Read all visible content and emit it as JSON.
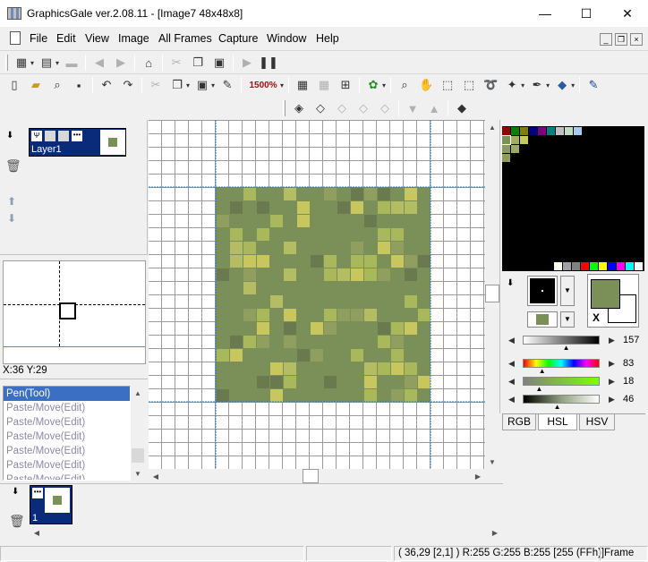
{
  "window": {
    "title": "GraphicsGale ver.2.08.11 - [Image7 48x48x8]",
    "min": "—",
    "max": "☐",
    "close": "✕"
  },
  "menu": [
    "File",
    "Edit",
    "View",
    "Image",
    "All Frames",
    "Capture",
    "Window",
    "Help"
  ],
  "mdi": {
    "min": "_",
    "restore": "❐",
    "close": "×"
  },
  "toolbar": {
    "zoom": "1500%"
  },
  "layer_panel": {
    "layer_name": "Layer1"
  },
  "navigator": {
    "coords": "X:36 Y:29"
  },
  "history": {
    "items": [
      "Pen(Tool)",
      "Paste/Move(Edit)",
      "Paste/Move(Edit)",
      "Paste/Move(Edit)",
      "Paste/Move(Edit)",
      "Paste/Move(Edit)",
      "Paste/Move(Edit)"
    ],
    "selected_index": 0
  },
  "frames": {
    "frame_number": "1"
  },
  "colors": {
    "primary": "#7b8f59",
    "secondary": "#ffffff",
    "swap_label": "X",
    "sliders": [
      {
        "label": "lightness-slider",
        "value": "157",
        "gradient": "linear-gradient(90deg,#fff,#000)",
        "marker": 52
      },
      {
        "label": "hue-slider",
        "value": "83",
        "gradient": "linear-gradient(90deg,#f00,#ff0,#0f0,#0ff,#00f,#f0f,#f00)",
        "marker": 20
      },
      {
        "label": "saturation-slider",
        "value": "18",
        "gradient": "linear-gradient(90deg,#808080,#7fff00)",
        "marker": 16
      },
      {
        "label": "luminance-slider",
        "value": "46",
        "gradient": "linear-gradient(90deg,#000,#90a080,#fff)",
        "marker": 40
      }
    ],
    "tabs": [
      "RGB",
      "HSL",
      "HSV"
    ],
    "active_tab": "HSL"
  },
  "palette": {
    "row1": [
      "#8c0000",
      "#008000",
      "#808000",
      "#000080",
      "#800080",
      "#008080",
      "#c0c0c0",
      "#c0dcc0",
      "#a6caf0",
      "#000000",
      "#000000",
      "#000000",
      "#000000",
      "#000000",
      "#000000",
      "#000000"
    ],
    "row2": [
      "#7b8f59",
      "#a0b060",
      "#c8c860",
      "#000000"
    ],
    "row3": [
      "#8c9a5e",
      "#9cac66",
      "#000000"
    ],
    "row4": [
      "#8c9e62"
    ],
    "bottom": [
      "#fffbf0",
      "#a0a0a4",
      "#808080",
      "#ff0000",
      "#00ff00",
      "#ffff00",
      "#0000ff",
      "#ff00ff",
      "#00ffff",
      "#ffffff"
    ]
  },
  "status": {
    "coord": "( 36,29 [2,1] ) R:255 G:255 B:255  [255 (FFh)]",
    "mode": "Frame"
  }
}
